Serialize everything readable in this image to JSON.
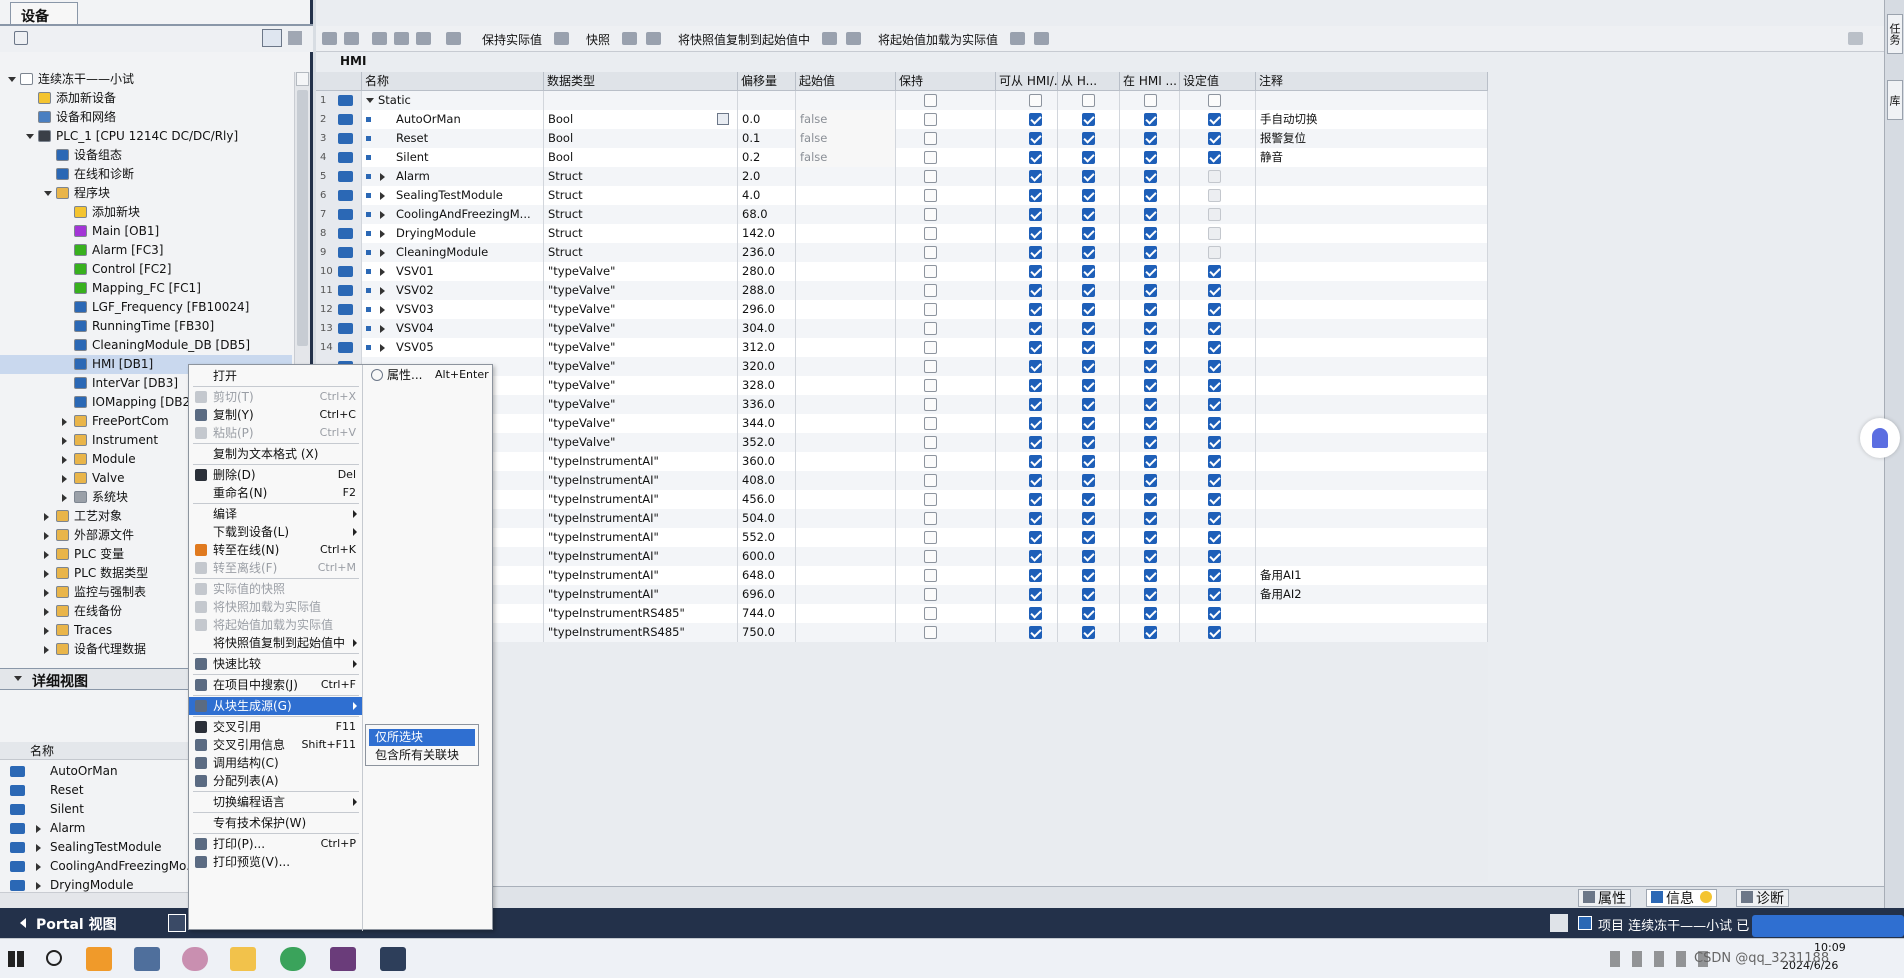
{
  "left_panel": {
    "tab_label": "设备",
    "tree": [
      {
        "label": "连续冻干——小试",
        "level": 0,
        "exp": "d",
        "icon": "project-icon",
        "color": "#ffffff"
      },
      {
        "label": "添加新设备",
        "level": 1,
        "exp": "",
        "icon": "add-device-icon",
        "color": "#f4c430"
      },
      {
        "label": "设备和网络",
        "level": 1,
        "exp": "",
        "icon": "network-icon",
        "color": "#4a7fc1"
      },
      {
        "label": "PLC_1 [CPU 1214C DC/DC/Rly]",
        "level": 1,
        "exp": "d",
        "icon": "plc-icon",
        "color": "#3a3f47"
      },
      {
        "label": "设备组态",
        "level": 2,
        "exp": "",
        "icon": "device-config-icon",
        "color": "#2b68b5"
      },
      {
        "label": "在线和诊断",
        "level": 2,
        "exp": "",
        "icon": "diagnostics-icon",
        "color": "#2b68b5"
      },
      {
        "label": "程序块",
        "level": 2,
        "exp": "d",
        "icon": "folder-icon",
        "color": "#e9b54a"
      },
      {
        "label": "添加新块",
        "level": 3,
        "exp": "",
        "icon": "add-block-icon",
        "color": "#f4c430"
      },
      {
        "label": "Main [OB1]",
        "level": 3,
        "exp": "",
        "icon": "ob-icon",
        "color": "#a335d6"
      },
      {
        "label": "Alarm [FC3]",
        "level": 3,
        "exp": "",
        "icon": "fc-icon",
        "color": "#38b01e"
      },
      {
        "label": "Control [FC2]",
        "level": 3,
        "exp": "",
        "icon": "fc-icon",
        "color": "#38b01e"
      },
      {
        "label": "Mapping_FC [FC1]",
        "level": 3,
        "exp": "",
        "icon": "fc-icon",
        "color": "#38b01e"
      },
      {
        "label": "LGF_Frequency [FB10024]",
        "level": 3,
        "exp": "",
        "icon": "fb-icon",
        "color": "#2b68b5"
      },
      {
        "label": "RunningTime [FB30]",
        "level": 3,
        "exp": "",
        "icon": "fb-icon",
        "color": "#2b68b5"
      },
      {
        "label": "CleaningModule_DB [DB5]",
        "level": 3,
        "exp": "",
        "icon": "db-icon",
        "color": "#2b68b5"
      },
      {
        "label": "HMI [DB1]",
        "level": 3,
        "exp": "",
        "icon": "db-icon",
        "color": "#2b68b5",
        "selected": true
      },
      {
        "label": "InterVar [DB3]",
        "level": 3,
        "exp": "",
        "icon": "db-icon",
        "color": "#2b68b5"
      },
      {
        "label": "IOMapping [DB2",
        "level": 3,
        "exp": "",
        "icon": "db-icon",
        "color": "#2b68b5"
      },
      {
        "label": "FreePortCom",
        "level": 3,
        "exp": "r",
        "icon": "folder-icon",
        "color": "#e9b54a"
      },
      {
        "label": "Instrument",
        "level": 3,
        "exp": "r",
        "icon": "folder-icon",
        "color": "#e9b54a"
      },
      {
        "label": "Module",
        "level": 3,
        "exp": "r",
        "icon": "folder-icon",
        "color": "#e9b54a"
      },
      {
        "label": "Valve",
        "level": 3,
        "exp": "r",
        "icon": "folder-icon",
        "color": "#e9b54a"
      },
      {
        "label": "系统块",
        "level": 3,
        "exp": "r",
        "icon": "system-block-icon",
        "color": "#9aa0a8"
      },
      {
        "label": "工艺对象",
        "level": 2,
        "exp": "r",
        "icon": "folder-icon",
        "color": "#e9b54a"
      },
      {
        "label": "外部源文件",
        "level": 2,
        "exp": "r",
        "icon": "folder-icon",
        "color": "#e9b54a"
      },
      {
        "label": "PLC 变量",
        "level": 2,
        "exp": "r",
        "icon": "folder-icon",
        "color": "#e9b54a"
      },
      {
        "label": "PLC 数据类型",
        "level": 2,
        "exp": "r",
        "icon": "folder-icon",
        "color": "#e9b54a"
      },
      {
        "label": "监控与强制表",
        "level": 2,
        "exp": "r",
        "icon": "folder-icon",
        "color": "#e9b54a"
      },
      {
        "label": "在线备份",
        "level": 2,
        "exp": "r",
        "icon": "folder-icon",
        "color": "#e9b54a"
      },
      {
        "label": "Traces",
        "level": 2,
        "exp": "r",
        "icon": "folder-icon",
        "color": "#e9b54a"
      },
      {
        "label": "设备代理数据",
        "level": 2,
        "exp": "r",
        "icon": "folder-icon",
        "color": "#e9b54a"
      }
    ],
    "detail_title": "详细视图",
    "detail_col": "名称",
    "detail_rows": [
      {
        "label": "AutoOrMan",
        "exp": ""
      },
      {
        "label": "Reset",
        "exp": ""
      },
      {
        "label": "Silent",
        "exp": ""
      },
      {
        "label": "Alarm",
        "exp": "r"
      },
      {
        "label": "SealingTestModule",
        "exp": "r"
      },
      {
        "label": "CoolingAndFreezingMo...",
        "exp": "r"
      },
      {
        "label": "DryingModule",
        "exp": "r"
      }
    ]
  },
  "toolbar": {
    "keep_actual": "保持实际值",
    "snapshot": "快照",
    "copy_snapshot": "将快照值复制到起始值中",
    "load_start": "将起始值加载为实际值"
  },
  "editor": {
    "title": "HMI",
    "columns": [
      "名称",
      "数据类型",
      "偏移量",
      "起始值",
      "保持",
      "可从 HMI/...",
      "从 H...",
      "在 HMI ...",
      "设定值",
      "注释"
    ],
    "static_label": "Static",
    "rows": [
      {
        "n": "1",
        "name": "Static",
        "type": "",
        "offset": "",
        "start": "",
        "keep": false,
        "acc": "off",
        "wr": "off",
        "vis": "off",
        "set": "off",
        "comment": "",
        "exp": "d",
        "static": true
      },
      {
        "n": "2",
        "name": "AutoOrMan",
        "type": "Bool",
        "offset": "0.0",
        "start": "false",
        "keep": false,
        "acc": "on",
        "wr": "on",
        "vis": "on",
        "set": "on",
        "comment": "手自动切换",
        "exp": ""
      },
      {
        "n": "3",
        "name": "Reset",
        "type": "Bool",
        "offset": "0.1",
        "start": "false",
        "keep": false,
        "acc": "on",
        "wr": "on",
        "vis": "on",
        "set": "on",
        "comment": "报警复位",
        "exp": ""
      },
      {
        "n": "4",
        "name": "Silent",
        "type": "Bool",
        "offset": "0.2",
        "start": "false",
        "keep": false,
        "acc": "on",
        "wr": "on",
        "vis": "on",
        "set": "on",
        "comment": "静音",
        "exp": ""
      },
      {
        "n": "5",
        "name": "Alarm",
        "type": "Struct",
        "offset": "2.0",
        "start": "",
        "keep": false,
        "acc": "on",
        "wr": "on",
        "vis": "on",
        "set": "dis",
        "comment": "",
        "exp": "r"
      },
      {
        "n": "6",
        "name": "SealingTestModule",
        "type": "Struct",
        "offset": "4.0",
        "start": "",
        "keep": false,
        "acc": "on",
        "wr": "on",
        "vis": "on",
        "set": "dis",
        "comment": "",
        "exp": "r"
      },
      {
        "n": "7",
        "name": "CoolingAndFreezingM...",
        "type": "Struct",
        "offset": "68.0",
        "start": "",
        "keep": false,
        "acc": "on",
        "wr": "on",
        "vis": "on",
        "set": "dis",
        "comment": "",
        "exp": "r"
      },
      {
        "n": "8",
        "name": "DryingModule",
        "type": "Struct",
        "offset": "142.0",
        "start": "",
        "keep": false,
        "acc": "on",
        "wr": "on",
        "vis": "on",
        "set": "dis",
        "comment": "",
        "exp": "r"
      },
      {
        "n": "9",
        "name": "CleaningModule",
        "type": "Struct",
        "offset": "236.0",
        "start": "",
        "keep": false,
        "acc": "on",
        "wr": "on",
        "vis": "on",
        "set": "dis",
        "comment": "",
        "exp": "r"
      },
      {
        "n": "10",
        "name": "VSV01",
        "type": "\"typeValve\"",
        "offset": "280.0",
        "start": "",
        "keep": false,
        "acc": "on",
        "wr": "on",
        "vis": "on",
        "set": "on",
        "comment": "",
        "exp": "r"
      },
      {
        "n": "11",
        "name": "VSV02",
        "type": "\"typeValve\"",
        "offset": "288.0",
        "start": "",
        "keep": false,
        "acc": "on",
        "wr": "on",
        "vis": "on",
        "set": "on",
        "comment": "",
        "exp": "r"
      },
      {
        "n": "12",
        "name": "VSV03",
        "type": "\"typeValve\"",
        "offset": "296.0",
        "start": "",
        "keep": false,
        "acc": "on",
        "wr": "on",
        "vis": "on",
        "set": "on",
        "comment": "",
        "exp": "r"
      },
      {
        "n": "13",
        "name": "VSV04",
        "type": "\"typeValve\"",
        "offset": "304.0",
        "start": "",
        "keep": false,
        "acc": "on",
        "wr": "on",
        "vis": "on",
        "set": "on",
        "comment": "",
        "exp": "r"
      },
      {
        "n": "14",
        "name": "VSV05",
        "type": "\"typeValve\"",
        "offset": "312.0",
        "start": "",
        "keep": false,
        "acc": "on",
        "wr": "on",
        "vis": "on",
        "set": "on",
        "comment": "",
        "exp": "r"
      },
      {
        "n": "",
        "name": "",
        "type": "\"typeValve\"",
        "offset": "320.0",
        "start": "",
        "keep": false,
        "acc": "on",
        "wr": "on",
        "vis": "on",
        "set": "on",
        "comment": "",
        "exp": ""
      },
      {
        "n": "",
        "name": "",
        "type": "\"typeValve\"",
        "offset": "328.0",
        "start": "",
        "keep": false,
        "acc": "on",
        "wr": "on",
        "vis": "on",
        "set": "on",
        "comment": "",
        "exp": ""
      },
      {
        "n": "",
        "name": "",
        "type": "\"typeValve\"",
        "offset": "336.0",
        "start": "",
        "keep": false,
        "acc": "on",
        "wr": "on",
        "vis": "on",
        "set": "on",
        "comment": "",
        "exp": ""
      },
      {
        "n": "",
        "name": "",
        "type": "\"typeValve\"",
        "offset": "344.0",
        "start": "",
        "keep": false,
        "acc": "on",
        "wr": "on",
        "vis": "on",
        "set": "on",
        "comment": "",
        "exp": ""
      },
      {
        "n": "",
        "name": "",
        "type": "\"typeValve\"",
        "offset": "352.0",
        "start": "",
        "keep": false,
        "acc": "on",
        "wr": "on",
        "vis": "on",
        "set": "on",
        "comment": "",
        "exp": ""
      },
      {
        "n": "",
        "name": "",
        "type": "\"typeInstrumentAI\"",
        "offset": "360.0",
        "start": "",
        "keep": false,
        "acc": "on",
        "wr": "on",
        "vis": "on",
        "set": "on",
        "comment": "",
        "exp": ""
      },
      {
        "n": "",
        "name": "",
        "type": "\"typeInstrumentAI\"",
        "offset": "408.0",
        "start": "",
        "keep": false,
        "acc": "on",
        "wr": "on",
        "vis": "on",
        "set": "on",
        "comment": "",
        "exp": ""
      },
      {
        "n": "",
        "name": "",
        "type": "\"typeInstrumentAI\"",
        "offset": "456.0",
        "start": "",
        "keep": false,
        "acc": "on",
        "wr": "on",
        "vis": "on",
        "set": "on",
        "comment": "",
        "exp": ""
      },
      {
        "n": "",
        "name": "",
        "type": "\"typeInstrumentAI\"",
        "offset": "504.0",
        "start": "",
        "keep": false,
        "acc": "on",
        "wr": "on",
        "vis": "on",
        "set": "on",
        "comment": "",
        "exp": ""
      },
      {
        "n": "",
        "name": "",
        "type": "\"typeInstrumentAI\"",
        "offset": "552.0",
        "start": "",
        "keep": false,
        "acc": "on",
        "wr": "on",
        "vis": "on",
        "set": "on",
        "comment": "",
        "exp": ""
      },
      {
        "n": "",
        "name": "",
        "type": "\"typeInstrumentAI\"",
        "offset": "600.0",
        "start": "",
        "keep": false,
        "acc": "on",
        "wr": "on",
        "vis": "on",
        "set": "on",
        "comment": "",
        "exp": ""
      },
      {
        "n": "",
        "name": "",
        "type": "\"typeInstrumentAI\"",
        "offset": "648.0",
        "start": "",
        "keep": false,
        "acc": "on",
        "wr": "on",
        "vis": "on",
        "set": "on",
        "comment": "备用AI1",
        "exp": ""
      },
      {
        "n": "",
        "name": "",
        "type": "\"typeInstrumentAI\"",
        "offset": "696.0",
        "start": "",
        "keep": false,
        "acc": "on",
        "wr": "on",
        "vis": "on",
        "set": "on",
        "comment": "备用AI2",
        "exp": ""
      },
      {
        "n": "",
        "name": "",
        "type": "\"typeInstrumentRS485\"",
        "offset": "744.0",
        "start": "",
        "keep": false,
        "acc": "on",
        "wr": "on",
        "vis": "on",
        "set": "on",
        "comment": "",
        "exp": ""
      },
      {
        "n": "",
        "name": "",
        "type": "\"typeInstrumentRS485\"",
        "offset": "750.0",
        "start": "",
        "keep": false,
        "acc": "on",
        "wr": "on",
        "vis": "on",
        "set": "on",
        "comment": "",
        "exp": ""
      }
    ]
  },
  "context_menu": {
    "items": [
      {
        "label": "打开",
        "sc": "",
        "sub": false,
        "dis": false,
        "icon": ""
      },
      {
        "sep": true
      },
      {
        "label": "剪切(T)",
        "sc": "Ctrl+X",
        "sub": false,
        "dis": true,
        "icon": "cut-icon"
      },
      {
        "label": "复制(Y)",
        "sc": "Ctrl+C",
        "sub": false,
        "dis": false,
        "icon": "copy-icon"
      },
      {
        "label": "粘贴(P)",
        "sc": "Ctrl+V",
        "sub": false,
        "dis": true,
        "icon": "paste-icon"
      },
      {
        "sep": true
      },
      {
        "label": "复制为文本格式 (X)",
        "sc": "",
        "sub": false,
        "dis": false,
        "icon": ""
      },
      {
        "sep": true
      },
      {
        "label": "删除(D)",
        "sc": "Del",
        "sub": false,
        "dis": false,
        "icon": "delete-icon"
      },
      {
        "label": "重命名(N)",
        "sc": "F2",
        "sub": false,
        "dis": false,
        "icon": ""
      },
      {
        "sep": true
      },
      {
        "label": "编译",
        "sc": "",
        "sub": true,
        "dis": false,
        "icon": ""
      },
      {
        "label": "下载到设备(L)",
        "sc": "",
        "sub": true,
        "dis": false,
        "icon": ""
      },
      {
        "label": "转至在线(N)",
        "sc": "Ctrl+K",
        "sub": false,
        "dis": false,
        "icon": "go-online-icon"
      },
      {
        "label": "转至离线(F)",
        "sc": "Ctrl+M",
        "sub": false,
        "dis": true,
        "icon": "go-offline-icon"
      },
      {
        "sep": true
      },
      {
        "label": "实际值的快照",
        "sc": "",
        "sub": false,
        "dis": true,
        "icon": "snapshot-icon"
      },
      {
        "label": "将快照加载为实际值",
        "sc": "",
        "sub": false,
        "dis": true,
        "icon": "load-snapshot-icon"
      },
      {
        "label": "将起始值加载为实际值",
        "sc": "",
        "sub": false,
        "dis": true,
        "icon": "load-start-icon"
      },
      {
        "label": "将快照值复制到起始值中",
        "sc": "",
        "sub": true,
        "dis": false,
        "icon": ""
      },
      {
        "sep": true
      },
      {
        "label": "快速比较",
        "sc": "",
        "sub": true,
        "dis": false,
        "icon": "compare-icon"
      },
      {
        "sep": true
      },
      {
        "label": "在项目中搜索(J)",
        "sc": "Ctrl+F",
        "sub": false,
        "dis": false,
        "icon": "search-icon"
      },
      {
        "sep": true
      },
      {
        "label": "从块生成源(G)",
        "sc": "",
        "sub": true,
        "dis": false,
        "icon": "generate-source-icon",
        "hl": true
      },
      {
        "sep": true
      },
      {
        "label": "交叉引用",
        "sc": "F11",
        "sub": false,
        "dis": false,
        "icon": "cross-ref-icon"
      },
      {
        "label": "交叉引用信息",
        "sc": "Shift+F11",
        "sub": false,
        "dis": false,
        "icon": "cross-ref-info-icon"
      },
      {
        "label": "调用结构(C)",
        "sc": "",
        "sub": false,
        "dis": false,
        "icon": "call-structure-icon"
      },
      {
        "label": "分配列表(A)",
        "sc": "",
        "sub": false,
        "dis": false,
        "icon": "assignment-icon"
      },
      {
        "sep": true
      },
      {
        "label": "切换编程语言",
        "sc": "",
        "sub": true,
        "dis": false,
        "icon": ""
      },
      {
        "sep": true
      },
      {
        "label": "专有技术保护(W)",
        "sc": "",
        "sub": false,
        "dis": false,
        "icon": ""
      },
      {
        "sep": true
      },
      {
        "label": "打印(P)...",
        "sc": "Ctrl+P",
        "sub": false,
        "dis": false,
        "icon": "print-icon"
      },
      {
        "label": "打印预览(V)...",
        "sc": "",
        "sub": false,
        "dis": false,
        "icon": "print-preview-icon"
      }
    ],
    "properties": "属性...",
    "properties_sc": "Alt+Enter",
    "submenu": [
      "仅所选块",
      "包含所有关联块"
    ]
  },
  "bottom": {
    "portal_view": "Portal 视图",
    "tab_properties": "属性",
    "tab_info": "信息",
    "tab_diag": "诊断",
    "project_status": "项目 连续冻干——小试 已"
  },
  "right_tabs": [
    "任务",
    "库"
  ],
  "taskbar": {
    "time": "10:09",
    "date": "2024/6/26",
    "watermark": "CSDN @qq_3231188"
  },
  "colors": {
    "accent": "#2f6fd1",
    "checkbox": "#1e5fb8",
    "dark_bar": "#23314a"
  }
}
